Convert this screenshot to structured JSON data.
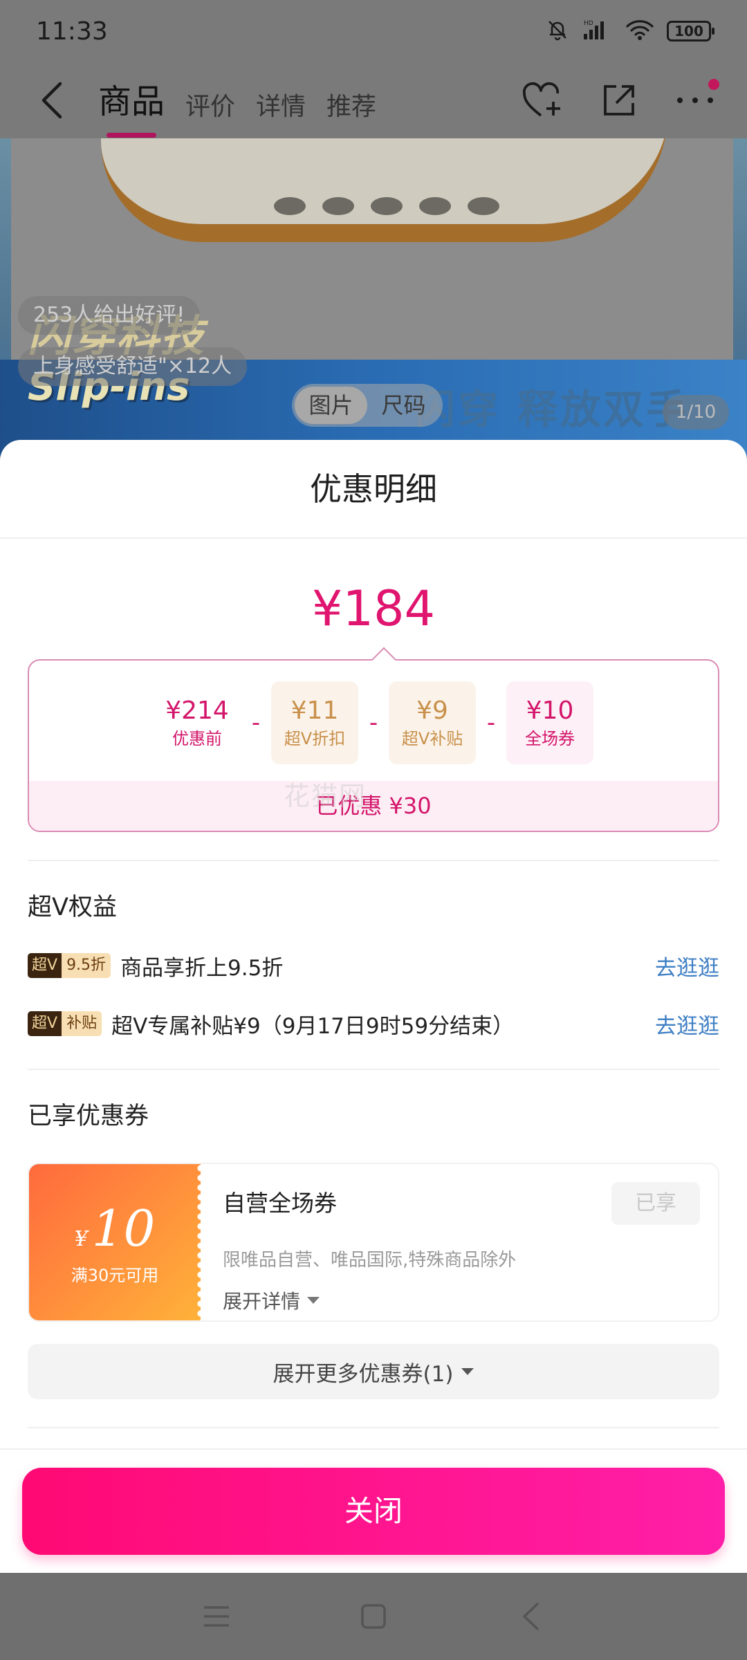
{
  "status_bar": {
    "time": "11:33",
    "battery": "100"
  },
  "nav": {
    "tabs": [
      {
        "label": "商品",
        "active": true
      },
      {
        "label": "评价",
        "active": false
      },
      {
        "label": "详情",
        "active": false
      },
      {
        "label": "推荐",
        "active": false
      }
    ]
  },
  "banner": {
    "logo_top": "闪穿科技",
    "logo_bottom": "Slip-ins",
    "slogan": "闪穿 释放双手",
    "review_count_text": "253人给出好评!",
    "review_tag_text": "上身感受舒适\"×12人",
    "tabs": [
      "图片",
      "尺码"
    ],
    "page_indicator": "1/10"
  },
  "sheet": {
    "title": "优惠明细",
    "final_price": "¥184",
    "breakdown": {
      "items": [
        {
          "value": "¥214",
          "label": "优惠前"
        },
        {
          "value": "¥11",
          "label": "超V折扣"
        },
        {
          "value": "¥9",
          "label": "超V补贴"
        },
        {
          "value": "¥10",
          "label": "全场券"
        }
      ],
      "minus": "-",
      "saved": "已优惠 ¥30"
    },
    "benefits": {
      "title": "超V权益",
      "items": [
        {
          "badge_main": "超V",
          "badge_sub": "9.5折",
          "text": "商品享折上9.5折",
          "link": "去逛逛"
        },
        {
          "badge_main": "超V",
          "badge_sub": "补贴",
          "text": "超V专属补贴¥9（9月17日9时59分结束）",
          "link": "去逛逛"
        }
      ]
    },
    "coupons": {
      "title": "已享优惠券",
      "items": [
        {
          "currency": "¥",
          "amount": "10",
          "condition": "满30元可用",
          "name": "自营全场券",
          "description": "限唯品自营、唯品国际,特殊商品除外",
          "expand_label": "展开详情",
          "status": "已享"
        }
      ],
      "more_label": "展开更多优惠券(1)"
    },
    "close_label": "关闭"
  },
  "watermark": "花猫网",
  "colors": {
    "accent": "#e0156f",
    "link": "#3f7fc4",
    "gold": "#c8904a",
    "close_button_start": "#ff0a74",
    "close_button_end": "#ff1fa8"
  },
  "icons": {
    "nav": [
      "back-arrow-icon",
      "favorite-add-icon",
      "share-icon",
      "more-icon"
    ],
    "status": [
      "mute-bell-icon",
      "signal-icon",
      "wifi-icon",
      "battery-icon"
    ],
    "system": [
      "menu-icon",
      "home-icon",
      "back-icon"
    ]
  }
}
